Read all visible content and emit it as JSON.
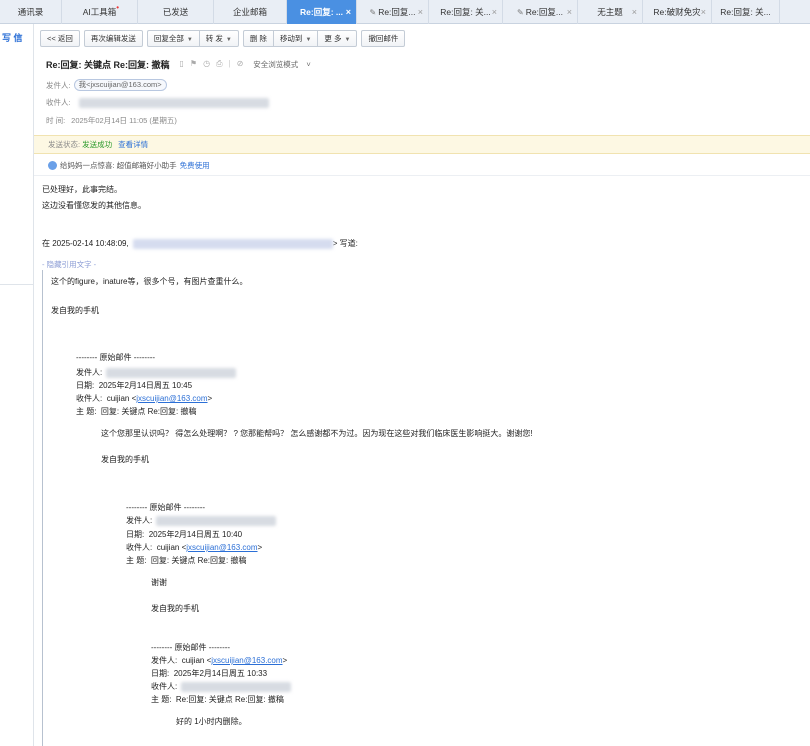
{
  "tabs": [
    {
      "label": "通讯录",
      "width": 62
    },
    {
      "label": "AI工具箱",
      "width": 76,
      "dot": true
    },
    {
      "label": "已发送",
      "width": 76
    },
    {
      "label": "企业邮箱",
      "width": 73
    },
    {
      "label": "Re:回复: ...",
      "width": 70,
      "active": true,
      "close": true
    },
    {
      "label": "Re:回复...",
      "width": 72,
      "edit": true,
      "close": true
    },
    {
      "label": "Re:回复: 关...",
      "width": 74,
      "close": true
    },
    {
      "label": "Re:回复...",
      "width": 75,
      "edit": true,
      "close": true
    },
    {
      "label": "无主题",
      "width": 65,
      "close": true
    },
    {
      "label": "Re:破财免灾",
      "width": 69,
      "close": true
    },
    {
      "label": "Re:回复: 关...",
      "width": 68
    }
  ],
  "left": {
    "write_label": "写 信"
  },
  "toolbar": {
    "back": "<< 返回",
    "edit_resend": "再次编辑发送",
    "reply_all": "回复全部",
    "forward": "转 发",
    "delete": "删 除",
    "move_to": "移动到",
    "more": "更 多",
    "recall": "撤回邮件"
  },
  "header": {
    "subject": "Re:回复: 关键点 Re:回复: 撤稿",
    "safe_mode": "安全浏览模式",
    "from_label": "发件人:",
    "from_value": "我<jxscuijian@163.com>",
    "to_label": "收件人:",
    "time_label": "时  间:",
    "time_value": "2025年02月14日 11:05 (星期五)"
  },
  "status": {
    "label": "发送状态:",
    "value": "发送成功",
    "link": "查看详情"
  },
  "promo": {
    "text": "给妈妈一点惊喜: 超值邮箱好小助手",
    "link": "免费使用"
  },
  "body": {
    "line1": "已处理好，此事完结。",
    "line2": "这边没看懂您发的其他信息。",
    "reply_prefix": "在 2025-02-14 10:48:09,",
    "reply_suffix": "> 写道:",
    "fold": "- 隐藏引用文字 -",
    "q1_line1": "这个的figure，inature等，很多个号，有图片查重什么。",
    "q1_sign": "发自我的手机",
    "orig1_header": "-------- 原始邮件 --------",
    "from_label": "发件人:",
    "date_label": "日期:",
    "to_label": "收件人:",
    "subject_label": "主 题:",
    "orig1_date": "2025年2月14日周五 10:45",
    "to_name": "cuijian <",
    "to_email": "jxscuijian@163.com",
    "to_close": ">",
    "orig1_subject": "回复: 关键点 Re:回复: 撤稿",
    "q2_line1": "这个您那里认识吗？ 得怎么处理啊？ ? 您那能帮吗？ 怎么感谢都不为过。因为现在这些对我们临床医生影响挺大。谢谢您!",
    "q2_sign": "发自我的手机",
    "orig2_header": "-------- 原始邮件 --------",
    "orig2_date": "2025年2月14日周五 10:40",
    "orig2_subject": "回复: 关键点 Re:回复: 撤稿",
    "q3_line1": "谢谢",
    "q3_sign": "发自我的手机",
    "orig3_header": "-------- 原始邮件 --------",
    "orig3_from": "cuijian <",
    "orig3_date": "2025年2月14日周五 10:33",
    "orig3_subject": "Re:回复: 关键点 Re:回复: 撤稿",
    "q4_line1": "好的 1小时内删除。"
  }
}
